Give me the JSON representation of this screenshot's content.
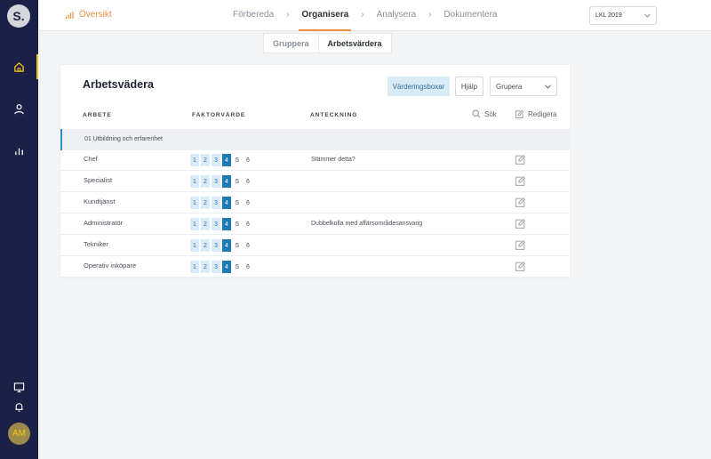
{
  "sidebar": {
    "logo": "S.",
    "avatar": "AM"
  },
  "topbar": {
    "overview": "Översikt",
    "steps": [
      "Förbereda",
      "Organisera",
      "Analysera",
      "Dokumentera"
    ],
    "active_step": "Organisera",
    "year": "LKL 2019"
  },
  "subtabs": [
    "Gruppera",
    "Arbetsvärdera"
  ],
  "card": {
    "title": "Arbetsvädera",
    "valuation_button": "Värderingsboxar",
    "help_button": "Hjälp",
    "group_select": "Grupera",
    "col_job": "ARBETE",
    "col_factor": "FAKTORVÄRDE",
    "col_note": "ANTECKNING",
    "search": "Sök",
    "edit": "Redigera",
    "section": "01 Utbildning och erfarenhet",
    "scale": [
      "1",
      "2",
      "3",
      "4",
      "5",
      "6"
    ],
    "rows": [
      {
        "name": "Chef",
        "selected": 4,
        "note": "Stämmer detta?"
      },
      {
        "name": "Specialist",
        "selected": 4,
        "note": ""
      },
      {
        "name": "Kundtjänst",
        "selected": 4,
        "note": ""
      },
      {
        "name": "Administratör",
        "selected": 4,
        "note": "Dubbelkolla med affärsområdesansvarig"
      },
      {
        "name": "Tekniker",
        "selected": 4,
        "note": ""
      },
      {
        "name": "Operativ inköpare",
        "selected": 4,
        "note": ""
      }
    ]
  },
  "colors": {
    "sidebar": "#1b2047",
    "accent_orange": "#e8913a",
    "accent_yellow": "#f5c518",
    "selected_blue": "#1a7bb5",
    "light_blue": "#d9ebf6"
  }
}
